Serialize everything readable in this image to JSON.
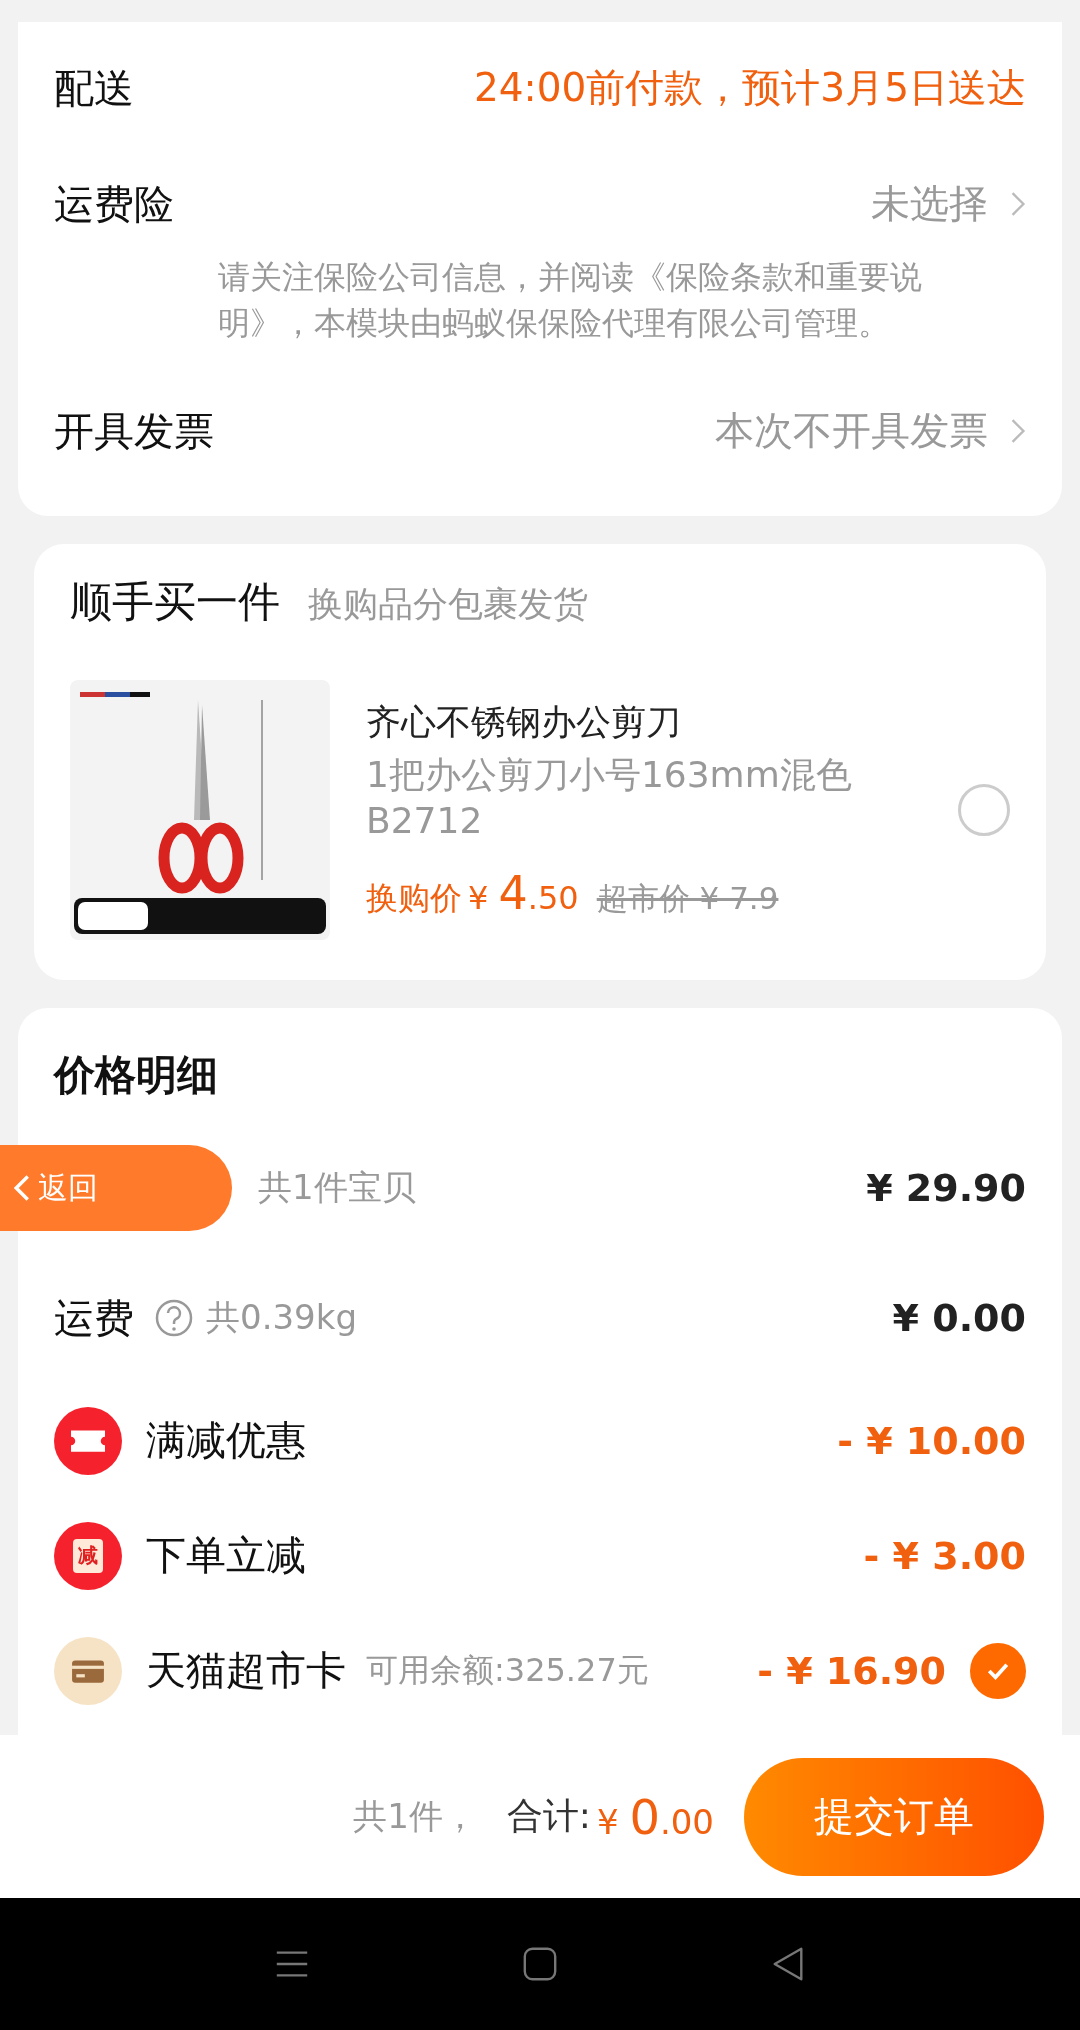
{
  "delivery": {
    "label": "配送",
    "value": "24:00前付款，预计3月5日送达"
  },
  "insurance": {
    "label": "运费险",
    "value": "未选择",
    "note": "请关注保险公司信息，并阅读《保险条款和重要说明》，本模块由蚂蚁保保险代理有限公司管理。"
  },
  "invoice": {
    "label": "开具发票",
    "value": "本次不开具发票"
  },
  "addon": {
    "title": "顺手买一件",
    "subtitle": "换购品分包裹发货",
    "item": {
      "name": "齐心不锈钢办公剪刀",
      "spec": "1把办公剪刀小号163mm混色B2712",
      "price_label": "换购价",
      "currency": "¥",
      "price_int": "4",
      "price_dec": ".50",
      "market_price": "超市价 ¥ 7.9",
      "selected": false
    }
  },
  "price_detail": {
    "title": "价格明细",
    "rows": [
      {
        "kind": "plain",
        "sub": "共1件宝贝",
        "amount": "¥ 29.90"
      },
      {
        "kind": "help",
        "label": "运费",
        "sub": "共0.39kg",
        "amount": "¥ 0.00"
      },
      {
        "kind": "coupon",
        "label": "满减优惠",
        "amount": "- ¥ 10.00"
      },
      {
        "kind": "instant",
        "label": "下单立减",
        "badge": "减",
        "amount": "- ¥ 3.00"
      },
      {
        "kind": "card",
        "label": "天猫超市卡",
        "sub": "可用余额:325.27元",
        "amount": "- ¥ 16.90",
        "checked": true
      }
    ]
  },
  "back_button": {
    "label": "返回"
  },
  "footer": {
    "count": "共1件，",
    "total_label": "合计:",
    "currency": "¥",
    "total_int": "0",
    "total_dec": ".00",
    "submit": "提交订单"
  }
}
